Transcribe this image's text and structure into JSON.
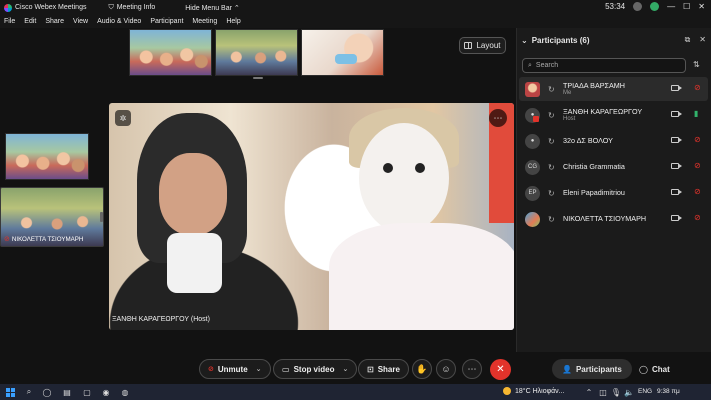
{
  "titlebar": {
    "app_name": "Cisco Webex Meetings",
    "meeting_info": "Meeting Info",
    "hide_menu_bar": "Hide Menu Bar",
    "timer": "53:34",
    "win_min": "—",
    "win_max": "☐",
    "win_close": "✕"
  },
  "menubar": {
    "items": [
      "File",
      "Edit",
      "Share",
      "View",
      "Audio & Video",
      "Participant",
      "Meeting",
      "Help"
    ]
  },
  "stage": {
    "layout_label": "Layout",
    "main_speaker_label": "ΞΑΝΘΗ ΚΑΡΑΓΕΩΡΓΟΥ (Host)",
    "left_thumb_label": "ΝΙΚΟΛΕΤΤΑ ΤΣΙΟΥΜΑΡΗ"
  },
  "panel": {
    "title": "Participants (6)",
    "search_placeholder": "Search",
    "participants": [
      {
        "name": "ΤΡΙΑΔΑ ΒΑΡΣΑΜΗ",
        "role": "Me",
        "initials": "",
        "mic": "muted"
      },
      {
        "name": "ΞΑΝΘΗ ΚΑΡΑΓΕΩΡΓΟΥ",
        "role": "Host",
        "initials": "",
        "mic": "on"
      },
      {
        "name": "32ο ΔΣ ΒΟΛΟΥ",
        "role": "",
        "initials": "",
        "mic": "muted"
      },
      {
        "name": "Christia Grammatia",
        "role": "",
        "initials": "CG",
        "mic": "muted"
      },
      {
        "name": "Eleni Papadimitriou",
        "role": "",
        "initials": "EP",
        "mic": "muted"
      },
      {
        "name": "ΝΙΚΟΛΕΤΤΑ ΤΣΙΟΥΜΑΡΗ",
        "role": "",
        "initials": "",
        "mic": "muted"
      }
    ]
  },
  "controls": {
    "unmute": "Unmute",
    "stop_video": "Stop video",
    "share": "Share",
    "participants": "Participants",
    "chat": "Chat"
  },
  "taskbar": {
    "weather": "18°C  Ηλιοφάν...",
    "lang": "ENG",
    "time": "9:38 πμ"
  },
  "colors": {
    "accent_red": "#e2332b",
    "mic_on_green": "#31b36b",
    "background": "#121212",
    "panel": "#1b1b1b"
  }
}
